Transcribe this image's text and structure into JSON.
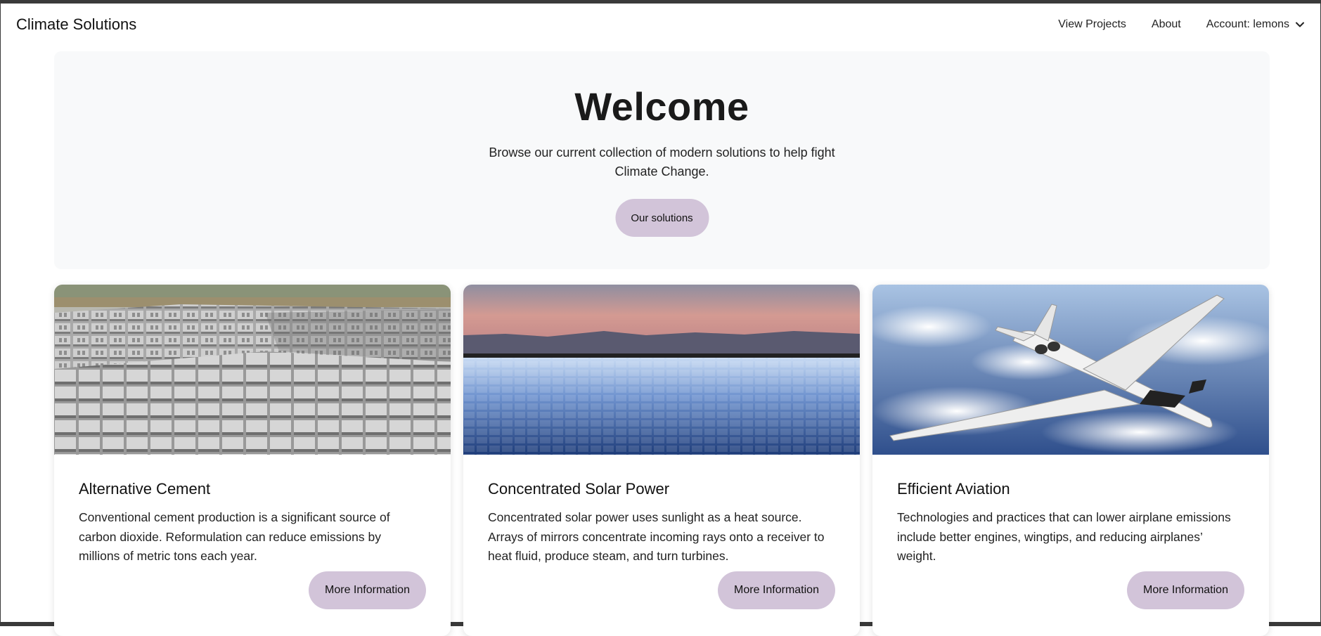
{
  "navbar": {
    "brand": "Climate Solutions",
    "links": [
      "View Projects",
      "About"
    ],
    "account_label": "Account: lemons"
  },
  "hero": {
    "title": "Welcome",
    "subtitle": "Browse our current collection of modern solutions to help fight Climate Change.",
    "button_label": "Our solutions"
  },
  "cards": [
    {
      "title": "Alternative Cement",
      "description": "Conventional cement production is a significant source of carbon dioxide. Reformulation can reduce emissions by millions of metric tons each year.",
      "button_label": "More Information",
      "image": "cement-blocks-photo"
    },
    {
      "title": "Concentrated Solar Power",
      "description": "Concentrated solar power uses sunlight as a heat source. Arrays of mirrors concentrate incoming rays onto a receiver to heat fluid, produce steam, and turn turbines.",
      "button_label": "More Information",
      "image": "solar-mirror-field-photo"
    },
    {
      "title": "Efficient Aviation",
      "description": "Technologies and practices that can lower airplane emissions include better engines, wingtips, and reducing airplanes’ weight.",
      "button_label": "More Information",
      "image": "airplane-over-clouds-photo"
    }
  ],
  "colors": {
    "accent_button": "#d2c4d9",
    "hero_background": "#f8f9fa"
  }
}
